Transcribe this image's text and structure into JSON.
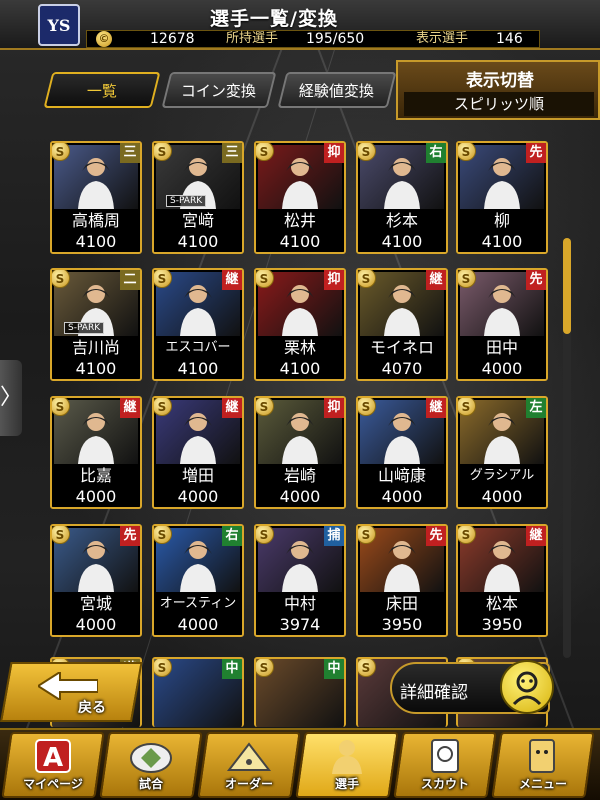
{
  "header": {
    "logo_text": "YS",
    "title": "選手一覧/変換",
    "coin_symbol": "©",
    "coins": "12678",
    "owned_label": "所持選手",
    "owned_value": "195/650",
    "shown_label": "表示選手",
    "shown_value": "146"
  },
  "tabs": [
    {
      "label": "一覧",
      "active": true
    },
    {
      "label": "コイン変換",
      "active": false
    },
    {
      "label": "経験値変換",
      "active": false
    }
  ],
  "display_toggle": {
    "title": "表示切替",
    "value": "スピリッツ順"
  },
  "side_arrow": "〉",
  "cards": [
    {
      "name": "高橋周",
      "value": "4100",
      "pos": "三",
      "pos_color": "#7a6a20",
      "bg": "#4a5a8a"
    },
    {
      "name": "宮﨑",
      "value": "4100",
      "pos": "三",
      "pos_color": "#7a6a20",
      "bg": "#3a3a3a",
      "logo": "S-PARK"
    },
    {
      "name": "松井",
      "value": "4100",
      "pos": "抑",
      "pos_color": "#c02020",
      "bg": "#7a1a1a"
    },
    {
      "name": "杉本",
      "value": "4100",
      "pos": "右",
      "pos_color": "#208030",
      "bg": "#4a4a6a"
    },
    {
      "name": "柳",
      "value": "4100",
      "pos": "先",
      "pos_color": "#c02020",
      "bg": "#3a4a7a"
    },
    {
      "name": "吉川尚",
      "value": "4100",
      "pos": "二",
      "pos_color": "#7a6a20",
      "bg": "#6a5a3a",
      "logo": "S-PARK"
    },
    {
      "name": "エスコバー",
      "value": "4100",
      "pos": "継",
      "pos_color": "#c02020",
      "bg": "#2a4a8a"
    },
    {
      "name": "栗林",
      "value": "4100",
      "pos": "抑",
      "pos_color": "#c02020",
      "bg": "#8a1a1a"
    },
    {
      "name": "モイネロ",
      "value": "4070",
      "pos": "継",
      "pos_color": "#c02020",
      "bg": "#6a5a2a"
    },
    {
      "name": "田中",
      "value": "4000",
      "pos": "先",
      "pos_color": "#c02020",
      "bg": "#7a5a6a"
    },
    {
      "name": "比嘉",
      "value": "4000",
      "pos": "継",
      "pos_color": "#c02020",
      "bg": "#5a5a4a"
    },
    {
      "name": "増田",
      "value": "4000",
      "pos": "継",
      "pos_color": "#c02020",
      "bg": "#3a3a7a"
    },
    {
      "name": "岩崎",
      "value": "4000",
      "pos": "抑",
      "pos_color": "#c02020",
      "bg": "#5a5a3a"
    },
    {
      "name": "山﨑康",
      "value": "4000",
      "pos": "継",
      "pos_color": "#c02020",
      "bg": "#3a5a9a"
    },
    {
      "name": "グラシアル",
      "value": "4000",
      "pos": "左",
      "pos_color": "#208030",
      "bg": "#8a6a2a"
    },
    {
      "name": "宮城",
      "value": "4000",
      "pos": "先",
      "pos_color": "#c02020",
      "bg": "#3a5a8a"
    },
    {
      "name": "オースティン",
      "value": "4000",
      "pos": "右",
      "pos_color": "#208030",
      "bg": "#2a5aaa"
    },
    {
      "name": "中村",
      "value": "3974",
      "pos": "捕",
      "pos_color": "#2060a0",
      "bg": "#4a3a6a"
    },
    {
      "name": "床田",
      "value": "3950",
      "pos": "先",
      "pos_color": "#c02020",
      "bg": "#9a4a1a"
    },
    {
      "name": "松本",
      "value": "3950",
      "pos": "継",
      "pos_color": "#c02020",
      "bg": "#8a3a2a"
    }
  ],
  "partial_cards": [
    {
      "pos": "遊",
      "pos_color": "#7a6a20",
      "bg": "#5a4a3a"
    },
    {
      "pos": "中",
      "pos_color": "#208030",
      "bg": "#2a4a8a"
    },
    {
      "pos": "中",
      "pos_color": "#208030",
      "bg": "#6a4a2a"
    },
    {
      "pos": "",
      "pos_color": "#c02020",
      "bg": "#5a3a3a"
    },
    {
      "pos": "",
      "pos_color": "#c02020",
      "bg": "#6a4a3a"
    }
  ],
  "back_button": {
    "label": "戻る"
  },
  "detail_button": {
    "label": "詳細確認"
  },
  "nav": [
    {
      "label": "マイページ",
      "icon": "a-emblem-icon",
      "active": false
    },
    {
      "label": "試合",
      "icon": "stadium-icon",
      "active": false
    },
    {
      "label": "オーダー",
      "icon": "field-icon",
      "active": false
    },
    {
      "label": "選手",
      "icon": "player-icon",
      "active": true
    },
    {
      "label": "スカウト",
      "icon": "scout-icon",
      "active": false
    },
    {
      "label": "メニュー",
      "icon": "menu-icon",
      "active": false
    }
  ]
}
